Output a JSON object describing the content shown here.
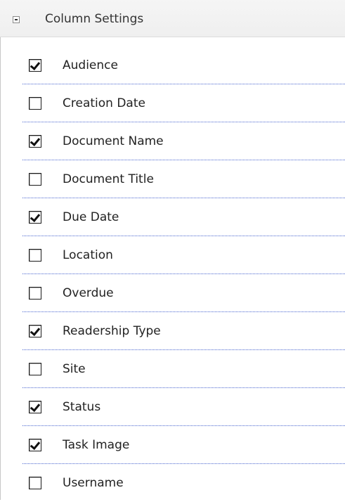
{
  "panel": {
    "title": "Column Settings",
    "collapse_icon": "minus-square-icon"
  },
  "columns": [
    {
      "label": "Audience",
      "checked": true
    },
    {
      "label": "Creation Date",
      "checked": false
    },
    {
      "label": "Document Name",
      "checked": true
    },
    {
      "label": "Document Title",
      "checked": false
    },
    {
      "label": "Due Date",
      "checked": true
    },
    {
      "label": "Location",
      "checked": false
    },
    {
      "label": "Overdue",
      "checked": false
    },
    {
      "label": "Readership Type",
      "checked": true
    },
    {
      "label": "Site",
      "checked": false
    },
    {
      "label": "Status",
      "checked": true
    },
    {
      "label": "Task Image",
      "checked": true
    },
    {
      "label": "Username",
      "checked": false
    }
  ],
  "colors": {
    "divider": "#4a66d0",
    "header_background": "#f2f2f2"
  }
}
